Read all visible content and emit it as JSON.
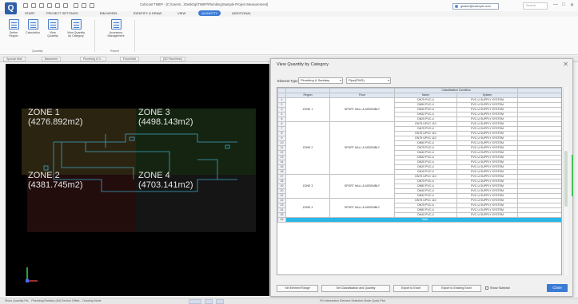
{
  "window": {
    "logo": "Q",
    "title": "Cubicost TMEP - [C:\\Users\\...\\Desktop\\TMEP\\Plumbing\\Sample Project Measurement]",
    "user": "glodon@example.com",
    "search_placeholder": "Search",
    "min": "—",
    "max": "□",
    "close": "✕"
  },
  "ribbon_tabs": [
    "START",
    "PROJECT SETTINGS",
    "BIM MODEL",
    "IDENTIFY & DRAW",
    "VIEW",
    "QUANTITY",
    "ADDITIONAL"
  ],
  "active_tab": "QUANTITY",
  "ribbon_buttons": [
    {
      "label1": "Define",
      "label2": "Region"
    },
    {
      "label1": "Calculation",
      "label2": ""
    },
    {
      "label1": "View",
      "label2": "Quantity"
    },
    {
      "label1": "View Quantity",
      "label2": "by Category"
    },
    {
      "label1": "Accessory",
      "label2": "Management"
    }
  ],
  "ribbon_groups": [
    "Quantity",
    "Report"
  ],
  "view_tabs": [
    "Special Wall",
    "Basement",
    "Plumbing & S...",
    "Floor/Wall",
    "[3D Plan/View]"
  ],
  "zones": [
    {
      "name": "ZONE 1",
      "area": "(4276.892m2)"
    },
    {
      "name": "ZONE 3",
      "area": "(4498.143m2)"
    },
    {
      "name": "ZONE 2",
      "area": "(4381.745m2)"
    },
    {
      "name": "ZONE 4",
      "area": "(4703.141m2)"
    }
  ],
  "axis_colors": {
    "x": "#d23a3a",
    "y": "#3bd24a",
    "z": "#4a6bff"
  },
  "dialog": {
    "title": "View Quantity by Category",
    "element_type_label": "Element Type",
    "element_type_value": "Plumbing & Sanitary",
    "subtype_value": "Pipe(PWS)",
    "classification_header": "Classification Condition",
    "columns": [
      "Region",
      "Floor",
      "Name",
      "System"
    ],
    "groups": [
      {
        "region": "ZONE 1",
        "floor": "SPORT HALL & ASSEMBLY",
        "rows": [
          {
            "name": "DN75 PVC-U",
            "system": "PVC-U SUPPLY SYSTEM"
          },
          {
            "name": "DN50 PVC-U",
            "system": "PVC-U SUPPLY SYSTEM"
          },
          {
            "name": "DN40 PVC-U",
            "system": "PVC-U SUPPLY SYSTEM"
          },
          {
            "name": "DN32 PVC-U",
            "system": "PVC-U SUPPLY SYSTEM"
          },
          {
            "name": "DN25 PVC-U",
            "system": "PVC-U SUPPLY SYSTEM"
          }
        ]
      },
      {
        "region": "ZONE 2",
        "floor": "SPORT HALL & ASSEMBLY",
        "rows": [
          {
            "name": "DN75 UPVC 110",
            "system": "PVC-U SUPPLY SYSTEM"
          },
          {
            "name": "DN75 PVC-U",
            "system": "PVC-U SUPPLY SYSTEM"
          },
          {
            "name": "DN75 UPVC 110",
            "system": "PVC-U SUPPLY SYSTEM"
          },
          {
            "name": "DN75 UPVC 110",
            "system": "PVC-U SUPPLY SYSTEM"
          },
          {
            "name": "DN50 PVC-U",
            "system": "PVC-U SUPPLY SYSTEM"
          },
          {
            "name": "DN75 PVC-U",
            "system": "PVC-U SUPPLY SYSTEM"
          },
          {
            "name": "DN40 PVC-U",
            "system": "PVC-U SUPPLY SYSTEM"
          },
          {
            "name": "DN32 PVC-U",
            "system": "PVC-U SUPPLY SYSTEM"
          },
          {
            "name": "DN25 PVC-U",
            "system": "PVC-U SUPPLY SYSTEM"
          },
          {
            "name": "DN20 PVC-U",
            "system": "PVC-U SUPPLY SYSTEM"
          },
          {
            "name": "DN15 PVC-U",
            "system": "PVC-U SUPPLY SYSTEM"
          }
        ]
      },
      {
        "region": "ZONE 3",
        "floor": "SPORT HALL & ASSEMBLY",
        "rows": [
          {
            "name": "DN75 UPVC 110",
            "system": "PVC-U SUPPLY SYSTEM"
          },
          {
            "name": "DN75 PVC-U",
            "system": "PVC-U SUPPLY SYSTEM"
          },
          {
            "name": "DN50 PVC-U",
            "system": "PVC-U SUPPLY SYSTEM"
          },
          {
            "name": "DN40 PVC-U",
            "system": "PVC-U SUPPLY SYSTEM"
          },
          {
            "name": "DN32 PVC-U",
            "system": "PVC-U SUPPLY SYSTEM"
          }
        ]
      },
      {
        "region": "ZONE 4",
        "floor": "SPORT HALL & ASSEMBLY",
        "rows": [
          {
            "name": "DN75 UPVC 110",
            "system": "PVC-U SUPPLY SYSTEM"
          },
          {
            "name": "DN75 PVC-U",
            "system": "PVC-U SUPPLY SYSTEM"
          },
          {
            "name": "DN50 PVC-U",
            "system": "PVC-U SUPPLY SYSTEM"
          },
          {
            "name": "DN40 PVC-U",
            "system": "PVC-U SUPPLY SYSTEM"
          }
        ]
      }
    ],
    "total_label": "Total",
    "buttons": [
      "Set Element Range",
      "Set Classification and Quantity",
      "Export to Excel",
      "Export to Existing Excel"
    ],
    "checkbox_label": "Show Subtotal",
    "ok_label": "Close",
    "close_icon": "✕"
  },
  "status": {
    "left": "Show Quantity Fie...   Plumbing/Sanitary (All)   Section Offset...   Drawing Mode",
    "right": "Fill Intersection  Element Selection Mode  Quick Pick"
  }
}
